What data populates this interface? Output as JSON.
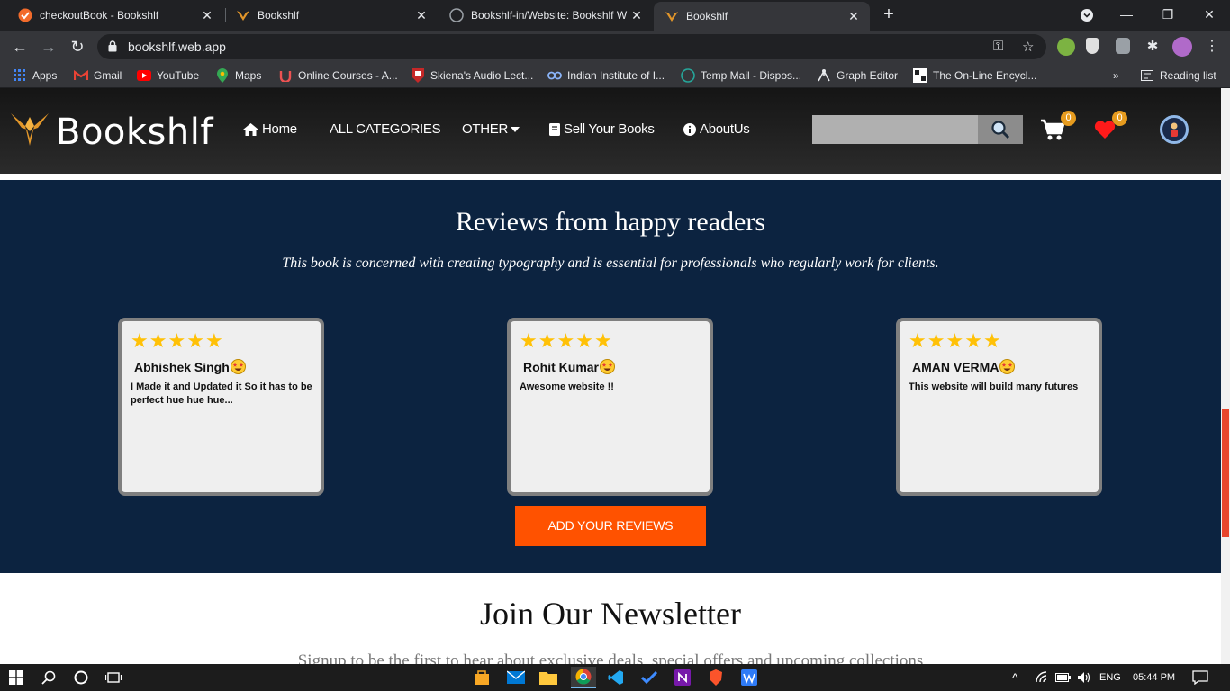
{
  "browser": {
    "tabs": [
      {
        "title": "checkoutBook - Bookshlf",
        "active": false
      },
      {
        "title": "Bookshlf",
        "active": false
      },
      {
        "title": "Bookshlf-in/Website: Bookshlf W",
        "active": false
      },
      {
        "title": "Bookshlf",
        "active": true
      }
    ],
    "url": "bookshlf.web.app",
    "bookmarks": [
      "Apps",
      "Gmail",
      "YouTube",
      "Maps",
      "Online Courses - A...",
      "Skiena's Audio Lect...",
      "Indian Institute of I...",
      "Temp Mail - Dispos...",
      "Graph Editor",
      "The On-Line Encycl..."
    ],
    "bookmarks_more": "»",
    "reading_list": "Reading list"
  },
  "site": {
    "logo": "Bookshlf",
    "nav": {
      "home": "Home",
      "categories": "ALL CATEGORIES",
      "other": "OTHER",
      "sell": "Sell Your Books",
      "about": "AboutUs"
    },
    "search_placeholder": "",
    "cart_count": "0",
    "wishlist_count": "0"
  },
  "reviews": {
    "title": "Reviews from happy readers",
    "subtitle": "This book is concerned with creating typography and is essential for professionals who regularly work for clients.",
    "items": [
      {
        "name": "Abhishek Singh",
        "text": "I Made it and Updated it So it has to be perfect hue hue hue...",
        "rating": 5
      },
      {
        "name": "Rohit Kumar",
        "text": "Awesome website !!",
        "rating": 5
      },
      {
        "name": "AMAN VERMA",
        "text": "This website will build many futures",
        "rating": 5
      }
    ],
    "add_button": "ADD YOUR REVIEWS"
  },
  "newsletter": {
    "title": "Join Our Newsletter",
    "subtitle": "Signup to be the first to hear about exclusive deals, special offers and upcoming collections"
  },
  "taskbar": {
    "language": "ENG",
    "time": "05:44 PM"
  },
  "colors": {
    "section_bg": "#0c2340",
    "button_accent": "#ff5200",
    "badge": "#e69b1e",
    "star": "#ffc107"
  }
}
